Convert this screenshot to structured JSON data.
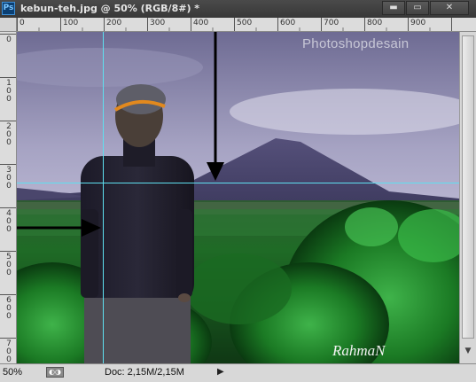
{
  "window": {
    "app_icon": "Ps",
    "title": "kebun-teh.jpg @ 50% (RGB/8#) *",
    "minimize_glyph": "▬",
    "maximize_glyph": "▭",
    "close_glyph": "✕"
  },
  "ruler": {
    "horizontal_labels": [
      "0",
      "100",
      "200",
      "300",
      "400",
      "500",
      "600",
      "700",
      "800",
      "900"
    ],
    "vertical_labels": [
      "0",
      "1 0 0",
      "2 0 0",
      "3 0 0",
      "4 0 0",
      "5 0 0",
      "6 0 0",
      "7 0 0"
    ]
  },
  "canvas": {
    "watermark": "Photoshopdesain",
    "signature": "RahmaN",
    "guide_color": "#5ee0f0",
    "arrow_color": "#000000"
  },
  "status": {
    "zoom": "50%",
    "doc_size": "Doc: 2,15M/2,15M",
    "menu_arrow": "▶"
  },
  "icons": [
    "photoshop-app-icon",
    "minimize-icon",
    "maximize-icon",
    "close-icon",
    "scroll-down-icon",
    "status-menu-arrow-icon"
  ]
}
